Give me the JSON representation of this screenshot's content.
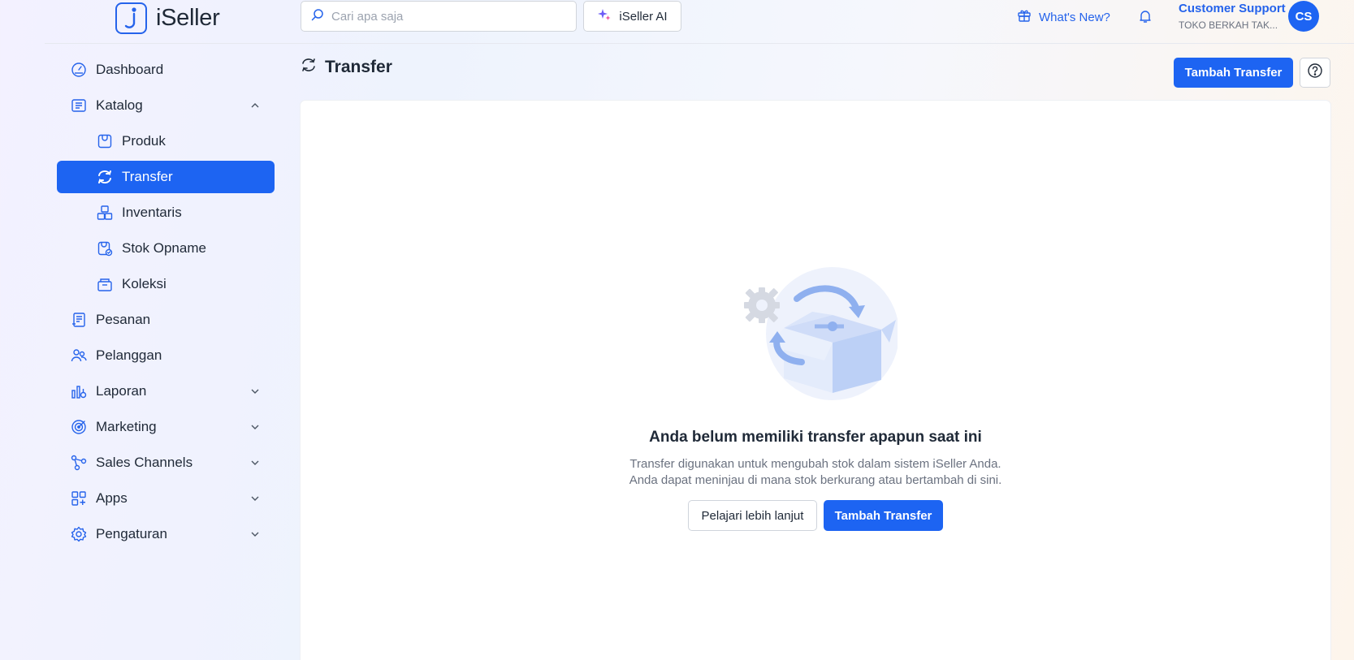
{
  "brand": {
    "name": "iSeller"
  },
  "search": {
    "placeholder": "Cari apa saja"
  },
  "ai_button": {
    "label": "iSeller AI"
  },
  "whats_new": {
    "label": "What's New?"
  },
  "user": {
    "name": "Customer Support",
    "store": "TOKO BERKAH TAK...",
    "initials": "CS"
  },
  "sidebar": {
    "items": [
      {
        "label": "Dashboard",
        "icon": "dashboard-icon",
        "expandable": false
      },
      {
        "label": "Katalog",
        "icon": "catalog-icon",
        "expandable": true,
        "expanded": true
      },
      {
        "label": "Produk",
        "icon": "product-icon",
        "sub": true
      },
      {
        "label": "Transfer",
        "icon": "transfer-icon",
        "sub": true,
        "active": true
      },
      {
        "label": "Inventaris",
        "icon": "inventory-icon",
        "sub": true
      },
      {
        "label": "Stok Opname",
        "icon": "stock-opname-icon",
        "sub": true
      },
      {
        "label": "Koleksi",
        "icon": "collection-icon",
        "sub": true
      },
      {
        "label": "Pesanan",
        "icon": "orders-icon",
        "expandable": false
      },
      {
        "label": "Pelanggan",
        "icon": "customers-icon",
        "expandable": false
      },
      {
        "label": "Laporan",
        "icon": "reports-icon",
        "expandable": true
      },
      {
        "label": "Marketing",
        "icon": "marketing-icon",
        "expandable": true
      },
      {
        "label": "Sales Channels",
        "icon": "sales-channels-icon",
        "expandable": true
      },
      {
        "label": "Apps",
        "icon": "apps-icon",
        "expandable": true
      },
      {
        "label": "Pengaturan",
        "icon": "settings-icon",
        "expandable": true
      }
    ]
  },
  "page": {
    "title": "Transfer",
    "add_button": "Tambah Transfer"
  },
  "empty_state": {
    "title": "Anda belum memiliki transfer apapun saat ini",
    "desc_line1": "Transfer digunakan untuk mengubah stok dalam sistem iSeller Anda.",
    "desc_line2": "Anda dapat meninjau di mana stok berkurang atau bertambah di sini.",
    "learn_more": "Pelajari lebih lanjut",
    "add_button": "Tambah Transfer"
  },
  "colors": {
    "accent": "#1d64f2",
    "text": "#1f2937",
    "muted": "#6b7280"
  }
}
